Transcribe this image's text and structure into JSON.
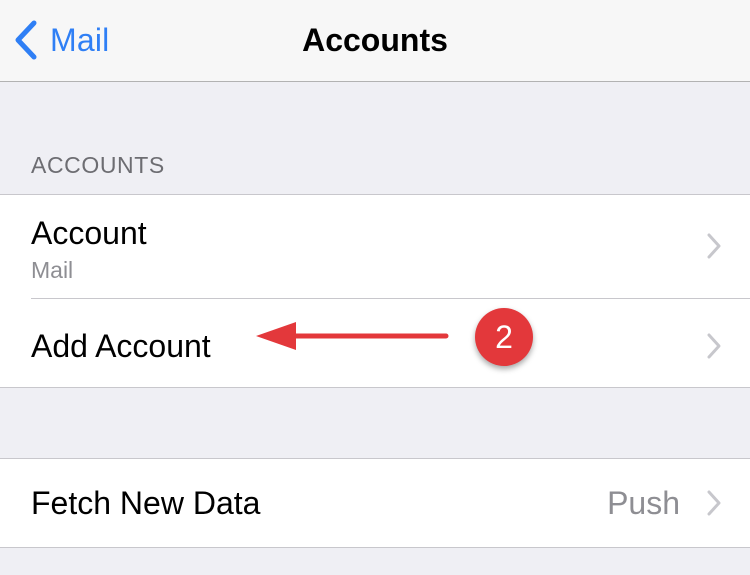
{
  "navbar": {
    "back_label": "Mail",
    "title": "Accounts"
  },
  "accounts_section": {
    "header": "ACCOUNTS",
    "rows": [
      {
        "title": "Account",
        "subtitle": "Mail"
      },
      {
        "title": "Add Account"
      }
    ]
  },
  "fetch_section": {
    "rows": [
      {
        "title": "Fetch New Data",
        "value": "Push"
      }
    ]
  },
  "annotation": {
    "step_number": "2"
  },
  "colors": {
    "accent": "#2f7ff5",
    "background": "#efeff4",
    "annotation_red": "#e3383b",
    "chevron": "#c7c7cc",
    "secondary_text": "#8e8e93"
  },
  "icons": {
    "back": "chevron-left-icon",
    "disclosure": "chevron-right-icon"
  }
}
